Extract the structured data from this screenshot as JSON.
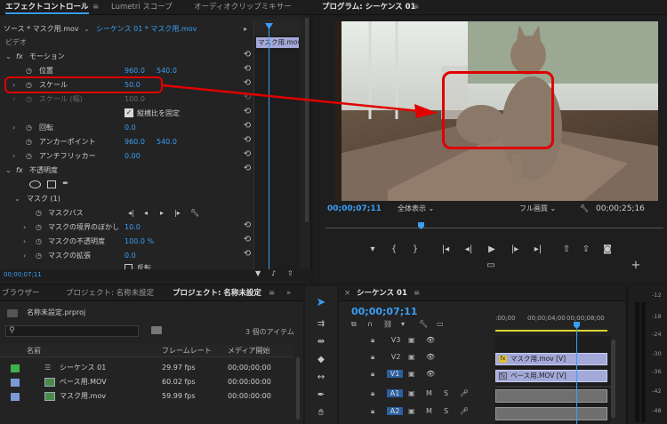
{
  "effect_controls": {
    "tabs": [
      {
        "label": "エフェクトコントロール",
        "active": true
      },
      {
        "label": "Lumetri スコープ",
        "active": false
      },
      {
        "label": "オーディオクリップミキサー",
        "active": false
      }
    ],
    "source_label": "ソース * マスク用.mov",
    "sequence_label": "シーケンス 01 * マスク用.mov",
    "clip_label": "マスク用.mov",
    "video_label": "ビデオ",
    "motion_label": "モーション",
    "position_label": "位置",
    "position_x": "960.0",
    "position_y": "540.0",
    "scale_label": "スケール",
    "scale_value": "50.0",
    "scale_width_label": "スケール (幅)",
    "scale_width_value": "100.0",
    "uniform_scale_label": "縦横比を固定",
    "rotation_label": "回転",
    "rotation_value": "0.0",
    "anchor_label": "アンカーポイント",
    "anchor_x": "960.0",
    "anchor_y": "540.0",
    "flicker_label": "アンチフリッカー",
    "flicker_value": "0.00",
    "opacity_label": "不透明度",
    "mask_label": "マスク (1)",
    "mask_path_label": "マスクパス",
    "mask_feather_label": "マスクの境界のぼかし",
    "mask_feather_value": "10.0",
    "mask_opacity_label": "マスクの不透明度",
    "mask_opacity_value": "100.0 %",
    "mask_expansion_label": "マスクの拡張",
    "mask_expansion_value": "0.0",
    "invert_label": "反転",
    "timecode": "00;00;07;11"
  },
  "program": {
    "title": "プログラム: シーケンス 01",
    "timecode": "00;00;07;11",
    "zoom": "全体表示",
    "quality": "フル画質",
    "duration": "00;00;25;16"
  },
  "project": {
    "tabs": [
      {
        "label": "ブラウザー",
        "active": false
      },
      {
        "label": "プロジェクト: 名称未設定",
        "active": false
      },
      {
        "label": "プロジェクト: 名称未設定",
        "active": true
      }
    ],
    "file_name": "名称未設定.prproj",
    "item_count": "3 個のアイテム",
    "columns": [
      "名前",
      "フレームレート",
      "メディア開始"
    ],
    "items": [
      {
        "name": "シーケンス 01",
        "fps": "29.97 fps",
        "start": "00;00;00;00",
        "color": "#3fb14c"
      },
      {
        "name": "ベース用.MOV",
        "fps": "60.02 fps",
        "start": "00:00:00:00",
        "color": "#7c9bd6"
      },
      {
        "name": "マスク用.mov",
        "fps": "59.99 fps",
        "start": "00:00:00:00",
        "color": "#7c9bd6"
      }
    ]
  },
  "timeline": {
    "title": "シーケンス 01",
    "timecode": "00;00;07;11",
    "ruler": [
      ":00;00",
      "00;00;04;00",
      "00;00;08;00"
    ],
    "tracks": [
      {
        "id": "V3",
        "target": false
      },
      {
        "id": "V2",
        "target": false
      },
      {
        "id": "V1",
        "target": true
      },
      {
        "id": "A1",
        "target": true
      },
      {
        "id": "A2",
        "target": true
      }
    ],
    "clip_v2": "マスク用.mov [V]",
    "clip_v1": "ベース用.MOV [V]",
    "m_label": "M",
    "s_label": "S"
  },
  "audio_meter": {
    "labels": [
      "-12",
      "-18",
      "-24",
      "-30",
      "-36",
      "-42",
      "-48"
    ]
  },
  "colors": {
    "accent": "#3a9ef5",
    "highlight": "#e00000"
  }
}
